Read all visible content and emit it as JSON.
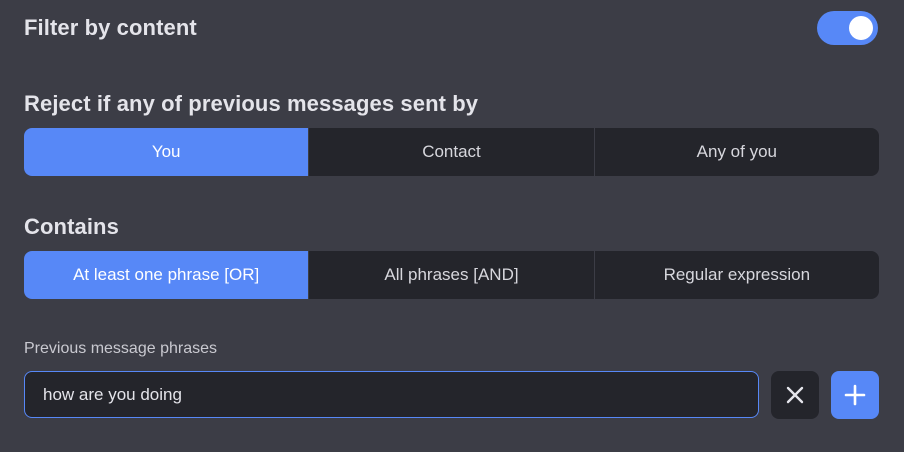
{
  "filter": {
    "title": "Filter by content",
    "enabled": true
  },
  "sender": {
    "title": "Reject if any of previous messages sent by",
    "options": [
      "You",
      "Contact",
      "Any of you"
    ],
    "selected": "You"
  },
  "contains": {
    "title": "Contains",
    "options": [
      "At least one phrase [OR]",
      "All phrases [AND]",
      "Regular expression"
    ],
    "selected": "At least one phrase [OR]"
  },
  "phrases": {
    "label": "Previous message phrases",
    "value": "how are you doing"
  },
  "icons": {
    "clear": "close-icon",
    "add": "plus-icon"
  },
  "colors": {
    "accent": "#5788f7",
    "background": "#3c3d46",
    "control": "#24252b"
  }
}
